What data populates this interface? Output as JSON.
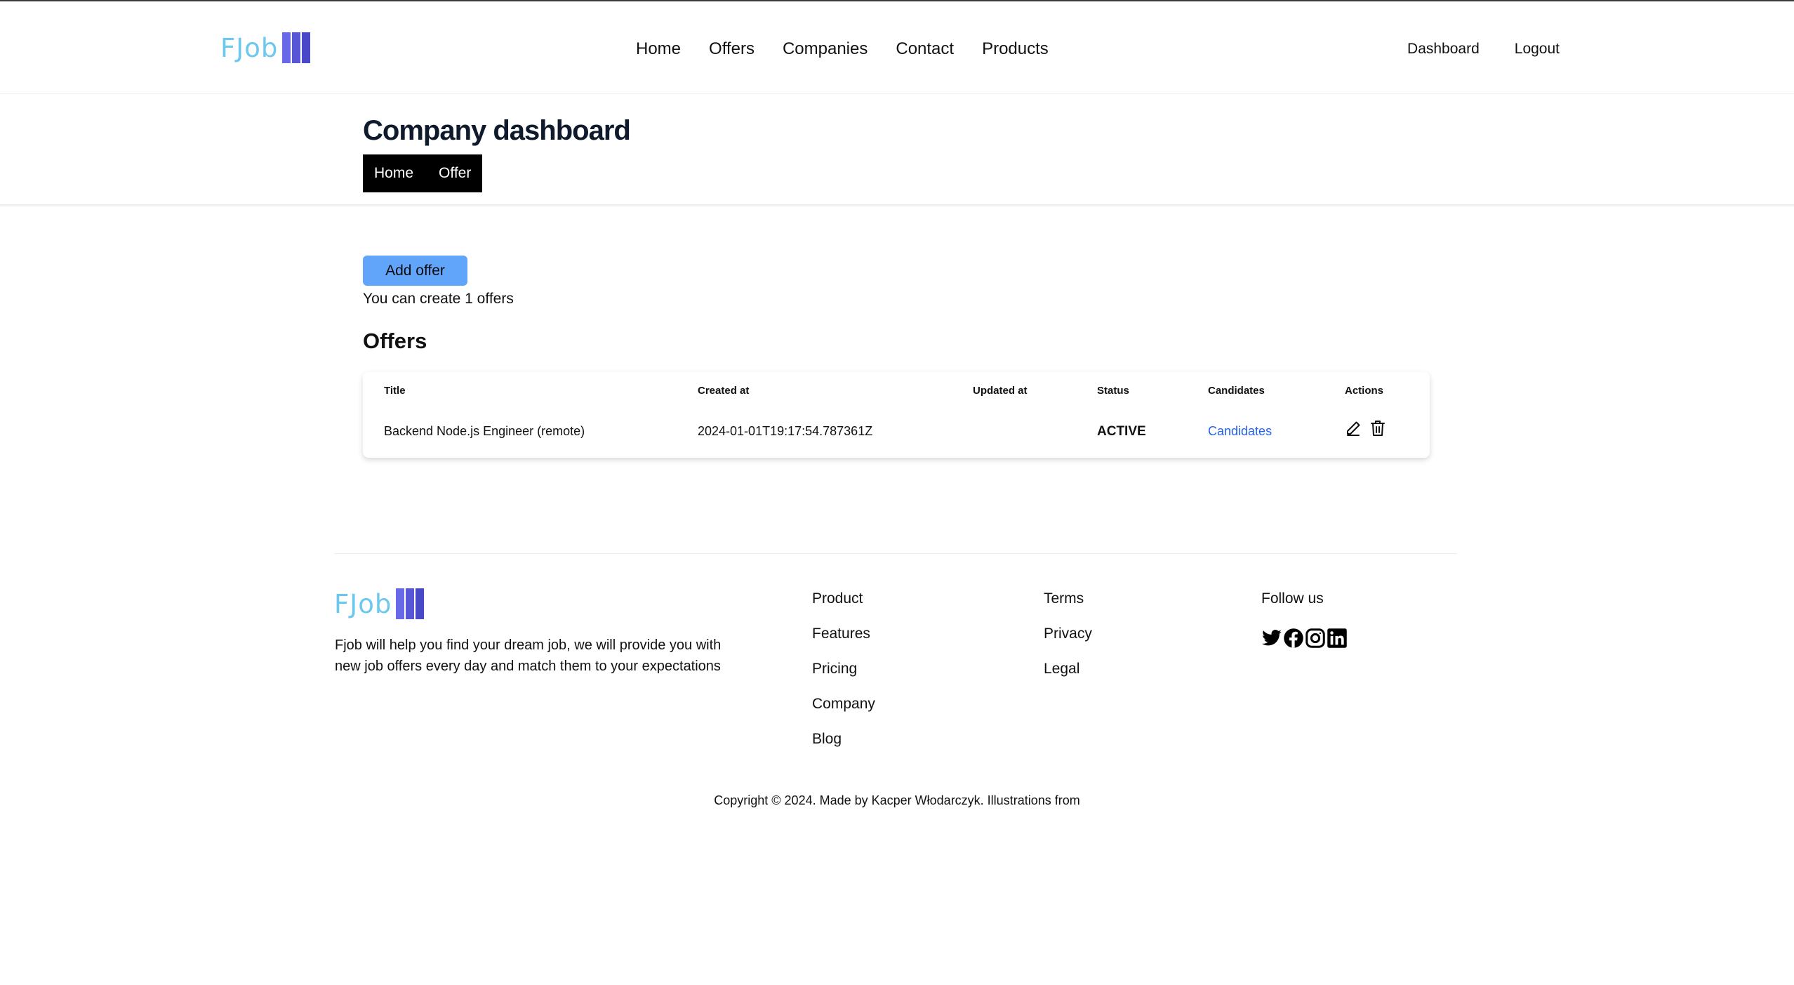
{
  "brand": {
    "name": "FJob",
    "colors": {
      "logo_text": "#6cc8ee",
      "logo_bars": "#5656d6",
      "accent_button": "#60a5fa",
      "link": "#2563eb"
    }
  },
  "nav": {
    "links": [
      "Home",
      "Offers",
      "Companies",
      "Contact",
      "Products"
    ],
    "dashboard": "Dashboard",
    "logout": "Logout"
  },
  "page": {
    "title": "Company dashboard",
    "breadcrumb": [
      "Home",
      "Offer"
    ]
  },
  "main": {
    "add_offer_label": "Add offer",
    "limit_text": "You can create 1 offers",
    "offers_heading": "Offers",
    "table": {
      "headers": [
        "Title",
        "Created at",
        "Updated at",
        "Status",
        "Candidates",
        "Actions"
      ],
      "rows": [
        {
          "title": "Backend Node.js Engineer (remote)",
          "created_at": "2024-01-01T19:17:54.787361Z",
          "updated_at": "",
          "status": "ACTIVE",
          "candidates": "Candidates",
          "actions": [
            "edit-icon",
            "trash-icon"
          ]
        }
      ]
    }
  },
  "footer": {
    "logo": "FJob",
    "description": "Fjob will help you find your dream job, we will provide you with new job offers every day and match them to your expectations",
    "col1": [
      "Product",
      "Features",
      "Pricing",
      "Company",
      "Blog"
    ],
    "col2": [
      "Terms",
      "Privacy",
      "Legal"
    ],
    "follow_us": "Follow us",
    "social_icons": [
      "twitter-icon",
      "facebook-icon",
      "instagram-icon",
      "linkedin-icon"
    ],
    "copyright": "Copyright © 2024. Made by Kacper Włodarczyk. Illustrations from"
  }
}
